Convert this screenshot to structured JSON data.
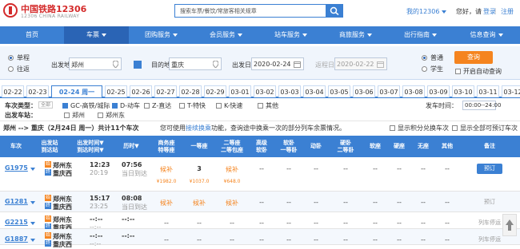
{
  "header": {
    "logo_title": "中国铁路12306",
    "logo_sub": "12306 CHINA RAILWAY",
    "search_placeholder": "搜索车票/餐饮/常旅客相关规章",
    "my_account": "我的12306",
    "greeting": "您好，请",
    "login": "登录",
    "register": "注册"
  },
  "nav": {
    "items": [
      "首页",
      "车票",
      "团购服务",
      "会员服务",
      "站车服务",
      "商旅服务",
      "出行指南",
      "信息查询"
    ],
    "active_index": 1
  },
  "query": {
    "trip_options": [
      "单程",
      "往返"
    ],
    "selected_trip": "单程",
    "from_label": "出发地",
    "from_value": "郑州",
    "to_label": "目的地",
    "to_value": "重庆",
    "depart_label": "出发日",
    "depart_value": "2020-02-24",
    "return_label": "返程日",
    "return_value": "2020-02-22",
    "ticket_options": [
      "普通",
      "学生"
    ],
    "selected_ticket": "普通",
    "query_button": "查询",
    "auto_query": "开启自动查询"
  },
  "dates": [
    "02-22",
    "02-23",
    "02-24 周一",
    "02-25",
    "02-26",
    "02-27",
    "02-28",
    "02-29",
    "03-01",
    "03-02",
    "03-03",
    "03-04",
    "03-05",
    "03-06",
    "03-07",
    "03-08",
    "03-09",
    "03-10",
    "03-11",
    "03-12"
  ],
  "active_date_index": 2,
  "filters": {
    "type_label": "车次类型：",
    "all_tag": "全部",
    "types": [
      "GC-高铁/城际",
      "D-动车",
      "Z-直达",
      "T-特快",
      "K-快速",
      "其他"
    ],
    "types_checked": [
      true,
      true,
      false,
      false,
      false,
      false
    ],
    "depart_station_label": "出发车站：",
    "stations": [
      "郑州",
      "郑州东"
    ],
    "time_label": "发车时间：",
    "time_value": "00:00--24:00"
  },
  "summary": {
    "route": "郑州 --> 重庆（2月24日 周一）共计11个车次",
    "hint_prefix": "您可使用",
    "hint_link": "接续换乘",
    "hint_suffix": "功能，查询途中换乘一次的部分列车余票情况。",
    "opt_points": "显示积分兑换车次",
    "opt_all": "显示全部可预订车次"
  },
  "table_headers": [
    "车次",
    "出发站\n到达站",
    "出发时间▼\n到达时间▼",
    "历时▼",
    "商务座\n特等座",
    "一等座",
    "二等座\n二等包座",
    "高级\n软卧",
    "软卧\n一等卧",
    "动卧",
    "硬卧\n二等卧",
    "软座",
    "硬座",
    "无座",
    "其他",
    "备注"
  ],
  "trains": [
    {
      "number": "G1975",
      "from": "郑州东",
      "to": "重庆西",
      "depart": "12:23",
      "arrive": "20:19",
      "duration": "07:56",
      "arrival_day": "当日到达",
      "seats": [
        "候补",
        "3",
        "候补",
        "--",
        "--",
        "--",
        "--",
        "--",
        "--",
        "--",
        "--"
      ],
      "action": "预订",
      "action_active": true,
      "prices": [
        "¥1982.0",
        "¥1037.0",
        "¥648.0"
      ]
    },
    {
      "number": "G1281",
      "from": "郑州东",
      "to": "重庆西",
      "depart": "15:17",
      "arrive": "23:25",
      "duration": "08:08",
      "arrival_day": "当日到达",
      "seats": [
        "候补",
        "候补",
        "候补",
        "--",
        "--",
        "--",
        "--",
        "--",
        "--",
        "--",
        "--"
      ],
      "action": "预订",
      "action_active": false
    },
    {
      "number": "G2215",
      "from": "郑州东",
      "to": "重庆西",
      "depart": "--:--",
      "arrive": "--:--",
      "duration": "--:--",
      "arrival_day": "",
      "seats": [
        "--",
        "--",
        "--",
        "--",
        "--",
        "--",
        "--",
        "--",
        "--",
        "--",
        "--"
      ],
      "action": "列车停运",
      "action_active": false
    },
    {
      "number": "G1887",
      "from": "郑州东",
      "to": "重庆西",
      "depart": "--:--",
      "arrive": "--:--",
      "duration": "--:--",
      "arrival_day": "",
      "seats": [
        "--",
        "--",
        "--",
        "--",
        "--",
        "--",
        "--",
        "--",
        "--",
        "--",
        "--"
      ],
      "action": "列车停运",
      "action_active": false
    }
  ],
  "colors": {
    "primary": "#3b80d3",
    "accent": "#f5841f",
    "brand": "#d42b2b"
  }
}
